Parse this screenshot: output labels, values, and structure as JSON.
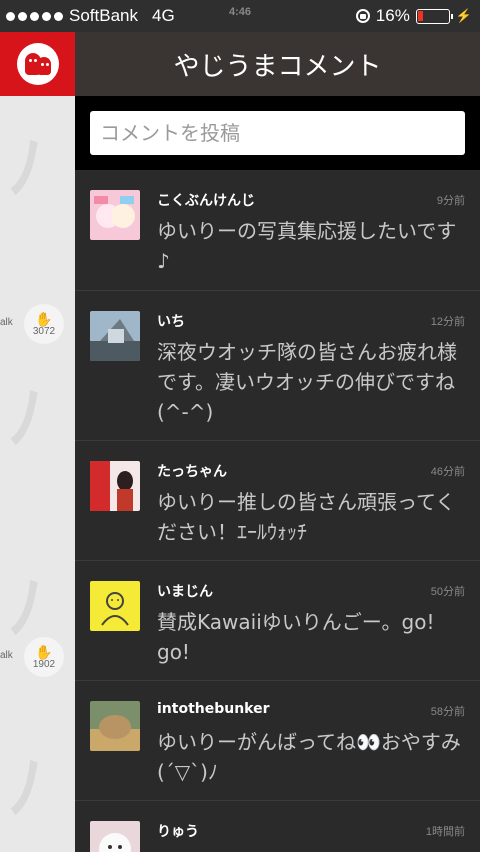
{
  "status": {
    "carrier": "SoftBank",
    "network": "4G",
    "time": "4:46",
    "battery": "16%"
  },
  "header": {
    "title": "やじうまコメント"
  },
  "search": {
    "placeholder": "コメントを投稿"
  },
  "sidebar": {
    "claps": [
      {
        "count": "3072",
        "fragment": "alk"
      },
      {
        "count": "1902",
        "fragment": "alk"
      }
    ]
  },
  "comments": [
    {
      "name": "こくぶんけんじ",
      "time": "9分前",
      "text": "ゆいりーの写真集応援したいです♪"
    },
    {
      "name": "いち",
      "time": "12分前",
      "text": "深夜ウオッチ隊の皆さんお疲れ様です。凄いウオッチの伸びですね(^-^)"
    },
    {
      "name": "たっちゃん",
      "time": "46分前",
      "text": "ゆいりー推しの皆さん頑張ってください！ｴｰﾙｳｫｯﾁ"
    },
    {
      "name": "いまじん",
      "time": "50分前",
      "text": "賛成Kawaiiゆいりんごー。go! go!"
    },
    {
      "name": "intothebunker",
      "time": "58分前",
      "text": "ゆいりーがんばってね👀おやすみ(´▽`)ﾉ"
    },
    {
      "name": "りゅう",
      "time": "1時間前",
      "text": ""
    }
  ],
  "colors": {
    "accent": "#d8141b",
    "header_bg": "#3a3532",
    "list_bg": "#2a2a2a"
  }
}
